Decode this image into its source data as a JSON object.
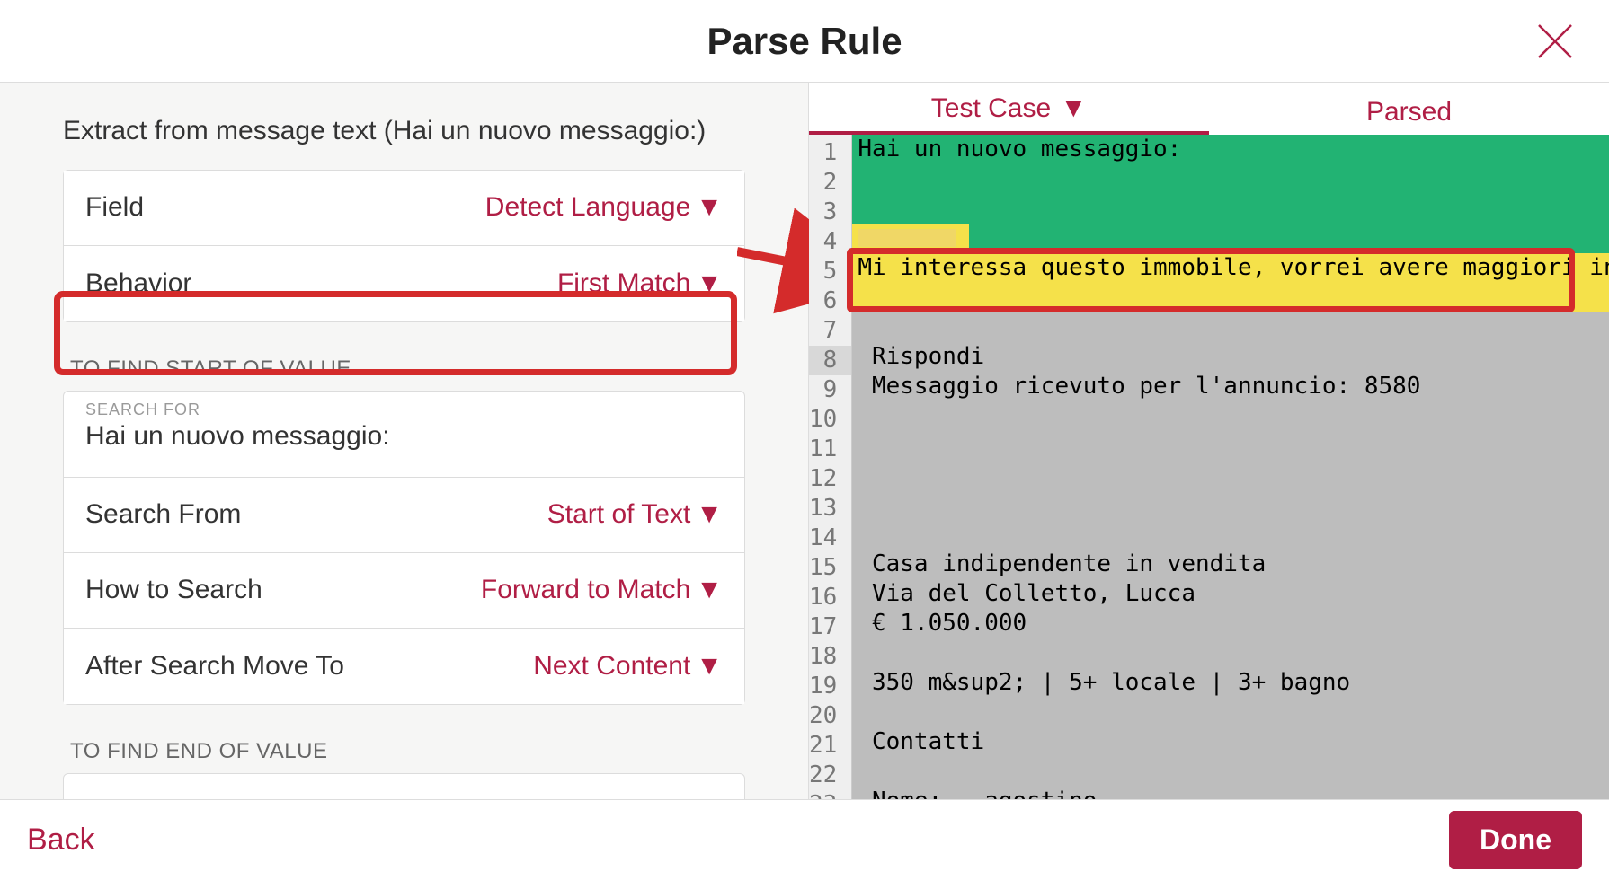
{
  "header": {
    "title": "Parse Rule"
  },
  "left": {
    "extract_title": "Extract from message text (Hai un nuovo messaggio:)",
    "field_label": "Field",
    "field_value": "Detect Language",
    "behavior_label": "Behavior",
    "behavior_value": "First Match",
    "start_section": "To Find Start of Value",
    "search_for_label": "search for",
    "search_for_value": "Hai un nuovo messaggio:",
    "search_from_label": "Search From",
    "search_from_value": "Start of Text",
    "how_to_search_label": "How to Search",
    "how_to_search_value": "Forward to Match",
    "after_search_label": "After Search Move To",
    "after_search_value": "Next Content",
    "end_section": "To Find End of Value"
  },
  "tabs": {
    "test_case": "Test Case",
    "parsed": "Parsed"
  },
  "code": {
    "l1": "Hai un nuovo messaggio:",
    "l2": "",
    "l3": "",
    "l4": "",
    "l5": "Mi interessa questo immobile, vorrei avere maggiori informazioni",
    "l6": "",
    "l7": "",
    "l8": " Rispondi",
    "l9": " Messaggio ricevuto per l'annuncio: 8580",
    "l10": "",
    "l11": "",
    "l12": "",
    "l13": "",
    "l14": "",
    "l15": " Casa indipendente in vendita",
    "l16": " Via del Colletto, Lucca",
    "l17": " € 1.050.000",
    "l18": "",
    "l19": " 350 m&sup2; | 5+ locale | 3+ bagno",
    "l20": "",
    "l21": " Contatti",
    "l22": "",
    "l23": " Nome:   agostino"
  },
  "footer": {
    "back": "Back",
    "done": "Done"
  },
  "colors": {
    "accent": "#b01e45",
    "annotation": "#d42b2b"
  }
}
